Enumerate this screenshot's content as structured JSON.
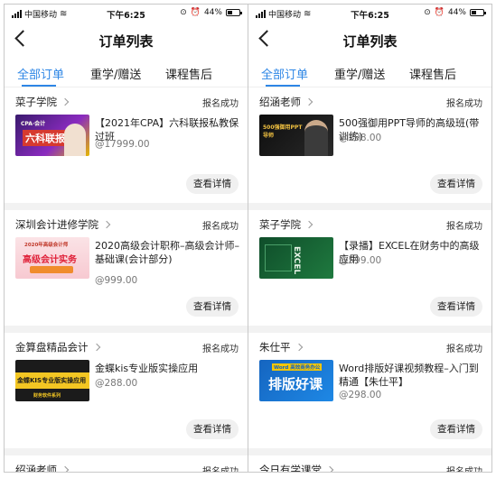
{
  "status_bar": {
    "carrier": "中国移动",
    "time": "下午6:25",
    "battery": "44%",
    "battery_level": 0.44
  },
  "nav": {
    "title": "订单列表"
  },
  "tabs": [
    "全部订单",
    "重学/赠送",
    "课程售后"
  ],
  "detail_label": "查看详情",
  "colors": {
    "accent": "#2d86e6"
  },
  "screens": [
    {
      "orders": [
        {
          "seller": "菜子学院",
          "status": "报名成功",
          "title": "【2021年CPA】六科联报私教保过班",
          "price": "@17999.00",
          "thumb_text": "六科联报",
          "thumb_sub": "CPA·会计"
        },
        {
          "seller": "深圳会计进修学院",
          "status": "报名成功",
          "title": "2020高级会计职称–高级会计师–基础课(会计部分)",
          "price": "@999.00",
          "thumb_text": "高级会计实务",
          "thumb_sub": "2020年高级会计师"
        },
        {
          "seller": "金算盘精品会计",
          "status": "报名成功",
          "title": "金蝶kis专业版实操应用",
          "price": "@288.00",
          "thumb_text": "金蝶KIS专业版实操应用",
          "thumb_sub": "财务软件系列"
        },
        {
          "seller": "绍涵老师",
          "status": "报名成功"
        }
      ]
    },
    {
      "orders": [
        {
          "seller": "绍涵老师",
          "status": "报名成功",
          "title": "500强御用PPT导师的高级班(带训练)",
          "price": "@298.00",
          "thumb_text": "500强御用PPT导师",
          "thumb_sub": ""
        },
        {
          "seller": "菜子学院",
          "status": "报名成功",
          "title": "【录播】EXCEL在财务中的高级应用",
          "price": "@599.00",
          "thumb_text": "EXCEL",
          "thumb_sub": ""
        },
        {
          "seller": "朱仕平",
          "status": "报名成功",
          "title": "Word排版好课视频教程–入门到精通【朱仕平】",
          "price": "@298.00",
          "thumb_text": "排版好课",
          "thumb_sub": "Word 高效商务办公"
        },
        {
          "seller": "今日有学课堂",
          "status": "报名成功"
        }
      ]
    }
  ]
}
